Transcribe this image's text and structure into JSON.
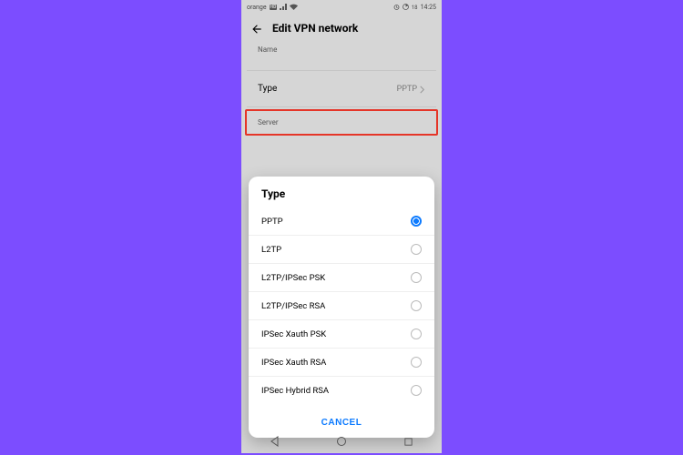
{
  "statusbar": {
    "carrier": "orange",
    "hd": "HD",
    "time": "14:25",
    "battery": "18"
  },
  "header": {
    "title": "Edit VPN network"
  },
  "fields": {
    "name_label": "Name",
    "type_label": "Type",
    "type_value": "PPTP",
    "server_label": "Server"
  },
  "sheet": {
    "title": "Type",
    "options": [
      {
        "label": "PPTP",
        "selected": true
      },
      {
        "label": "L2TP",
        "selected": false
      },
      {
        "label": "L2TP/IPSec PSK",
        "selected": false
      },
      {
        "label": "L2TP/IPSec RSA",
        "selected": false
      },
      {
        "label": "IPSec Xauth PSK",
        "selected": false
      },
      {
        "label": "IPSec Xauth RSA",
        "selected": false
      },
      {
        "label": "IPSec Hybrid RSA",
        "selected": false
      }
    ],
    "cancel": "CANCEL"
  }
}
